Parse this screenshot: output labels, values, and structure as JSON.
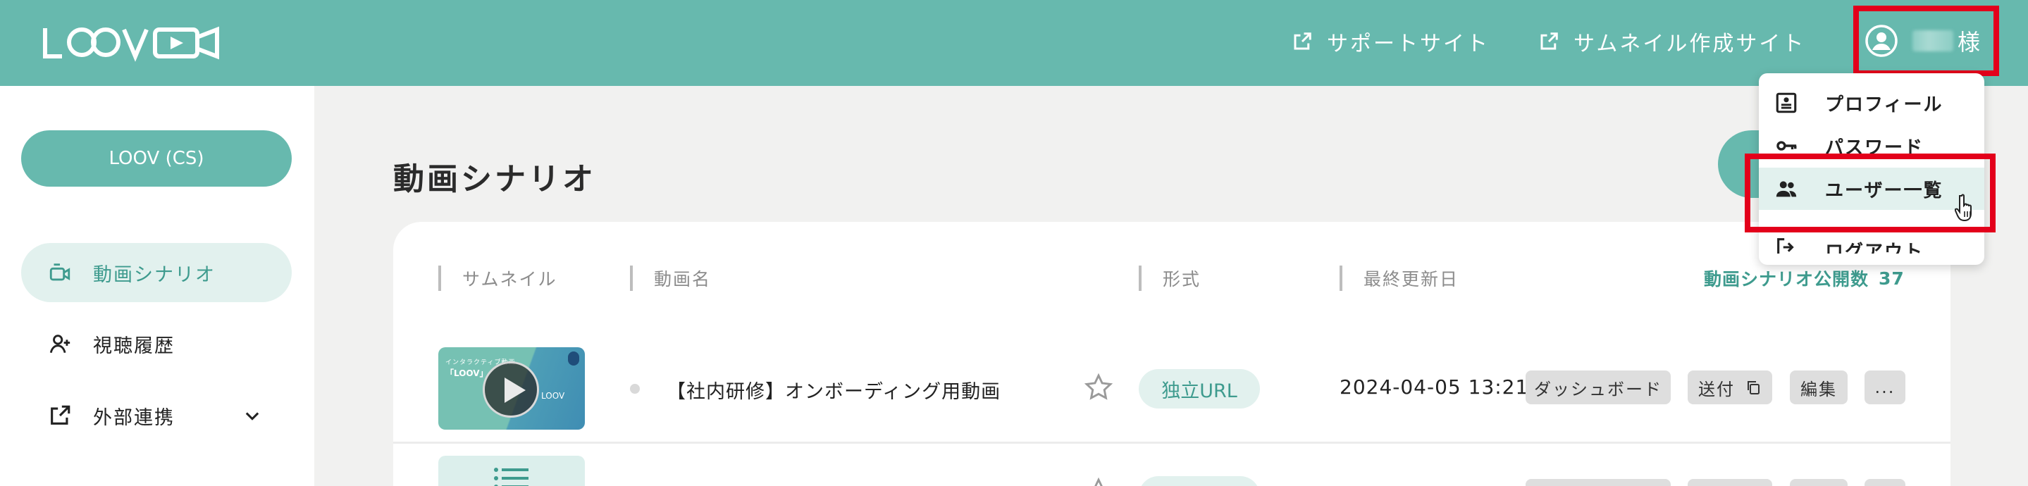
{
  "header": {
    "logo_text": "LOOV",
    "support_link": "サポートサイト",
    "thumbnail_link": "サムネイル作成サイト",
    "user_suffix": "様"
  },
  "sidebar": {
    "org_button": "LOOV (CS)",
    "items": [
      {
        "label": "動画シナリオ",
        "active": true,
        "icon": "video-scenario-icon"
      },
      {
        "label": "視聴履歴",
        "active": false,
        "icon": "add-user-icon"
      },
      {
        "label": "外部連携",
        "active": false,
        "icon": "external-link-icon"
      }
    ]
  },
  "main": {
    "title": "動画シナリオ",
    "columns": [
      "サムネイル",
      "動画名",
      "形式",
      "最終更新日"
    ],
    "count_label": "動画シナリオ公開数",
    "count_value": "37",
    "rows": [
      {
        "thumbnail_caption": "インタラクティブ動画",
        "thumbnail_title": "「LOOV」",
        "thumbnail_logo": "LOOV",
        "name": "【社内研修】オンボーディング用動画",
        "format": "独立URL",
        "updated": "2024-04-05 13:21",
        "actions": [
          "ダッシュボード",
          "送付",
          "編集",
          "..."
        ]
      }
    ]
  },
  "dropdown": {
    "items": [
      {
        "label": "プロフィール",
        "icon": "profile-icon"
      },
      {
        "label": "パスワード",
        "icon": "key-icon"
      },
      {
        "label": "ユーザー一覧",
        "icon": "users-icon",
        "hover": true
      },
      {
        "label": "ログアウト",
        "icon": "logout-icon"
      }
    ]
  },
  "colors": {
    "brand": "#67b9ae",
    "brand_light": "#e2f1ee",
    "brand_text": "#3e9b8e",
    "highlight": "#e3001b"
  }
}
